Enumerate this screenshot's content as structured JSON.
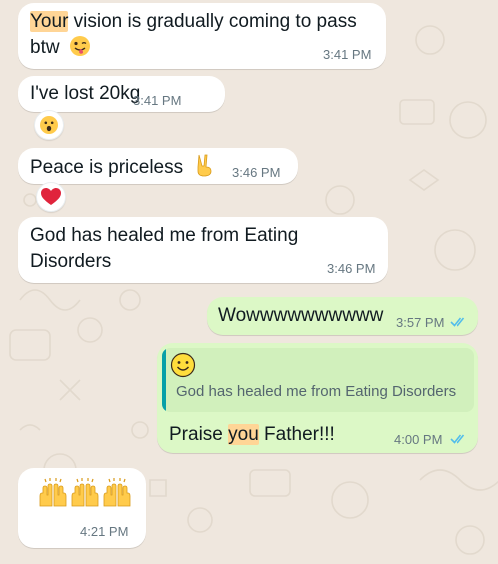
{
  "messages": [
    {
      "direction": "incoming",
      "line1_pre": "",
      "line1_highlight": "Your",
      "line1_post": " vision is gradually coming to pass",
      "line2": "btw",
      "emoji_icon": "winking-face-tongue-icon",
      "time": "3:41 PM"
    },
    {
      "direction": "incoming",
      "text": "I've lost 20kg",
      "time": "3:41 PM",
      "reaction_icon": "astonished-face-icon"
    },
    {
      "direction": "incoming",
      "text": "Peace is priceless",
      "emoji_icon": "victory-hand-icon",
      "time": "3:46 PM",
      "reaction_icon": "red-heart-icon"
    },
    {
      "direction": "incoming",
      "line1": "God has healed me from Eating",
      "line2": "Disorders",
      "time": "3:46 PM"
    },
    {
      "direction": "outgoing",
      "text": "Wowwwwwwwwww",
      "time": "3:57 PM",
      "status": "read"
    },
    {
      "direction": "outgoing",
      "quoted_icon": "smiling-face-icon",
      "quoted_text": "God has healed me from Eating Disorders",
      "pre": "Praise ",
      "highlight": "you",
      "post": " Father!!!",
      "time": "4:00 PM",
      "status": "read"
    },
    {
      "direction": "incoming",
      "emoji_icons": [
        "raising-hands-icon",
        "raising-hands-icon",
        "raising-hands-icon"
      ],
      "time": "4:21 PM"
    }
  ],
  "colors": {
    "wallpaper": "#efe7de",
    "incoming_bubble": "#ffffff",
    "outgoing_bubble": "#dcf8c6",
    "highlight": "#ffd596",
    "read_ticks": "#53bdeb",
    "quote_bar": "#06a0a8"
  }
}
